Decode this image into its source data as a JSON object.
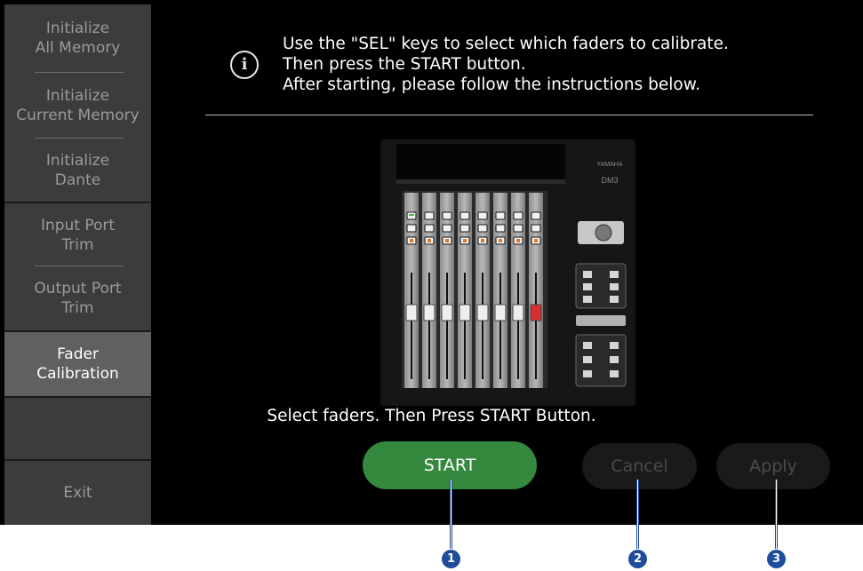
{
  "sidebar": {
    "items": [
      {
        "line1": "Initialize",
        "line2": "All Memory"
      },
      {
        "line1": "Initialize",
        "line2": "Current Memory"
      },
      {
        "line1": "Initialize",
        "line2": "Dante"
      },
      {
        "line1": "Input Port",
        "line2": "Trim"
      },
      {
        "line1": "Output Port",
        "line2": "Trim"
      },
      {
        "line1": "Fader",
        "line2": "Calibration",
        "active": true
      }
    ],
    "exit_label": "Exit"
  },
  "instructions": [
    "Use the \"SEL\" keys to select which faders to calibrate.",
    "Then press the START button.",
    "After starting, please follow the instructions below."
  ],
  "info_icon": "info-icon",
  "console": {
    "brand": "YAMAHA",
    "model": "DM3"
  },
  "status_text": "Select faders. Then Press START Button.",
  "buttons": {
    "start": "START",
    "cancel": "Cancel",
    "apply": "Apply"
  },
  "callouts": [
    "1",
    "2",
    "3"
  ],
  "colors": {
    "start_green": "#34893f",
    "callout_blue": "#1f4c9b",
    "active_item": "#606060"
  }
}
